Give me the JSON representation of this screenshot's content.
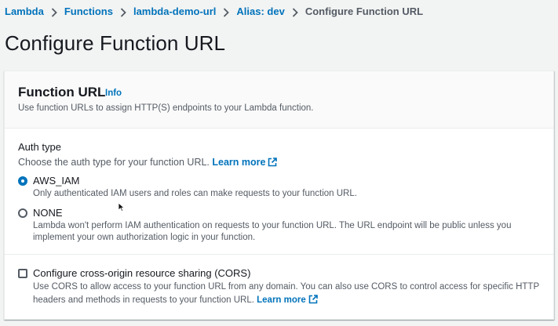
{
  "breadcrumb": {
    "items": [
      "Lambda",
      "Functions",
      "lambda-demo-url",
      "Alias: dev"
    ],
    "current": "Configure Function URL"
  },
  "page": {
    "title": "Configure Function URL"
  },
  "panel": {
    "title": "Function URL",
    "info": "Info",
    "description": "Use function URLs to assign HTTP(S) endpoints to your Lambda function."
  },
  "auth": {
    "label": "Auth type",
    "description": "Choose the auth type for your function URL.",
    "learn_more": "Learn more",
    "options": [
      {
        "label": "AWS_IAM",
        "selected": true,
        "description": "Only authenticated IAM users and roles can make requests to your function URL."
      },
      {
        "label": "NONE",
        "selected": false,
        "description": "Lambda won't perform IAM authentication on requests to your function URL. The URL endpoint will be public unless you implement your own authorization logic in your function."
      }
    ]
  },
  "cors": {
    "label": "Configure cross-origin resource sharing (CORS)",
    "checked": false,
    "description": "Use CORS to allow access to your function URL from any domain. You can also use CORS to control access for specific HTTP headers and methods in requests to your function URL.",
    "learn_more": "Learn more"
  },
  "colors": {
    "link": "#0073bb",
    "text": "#16191f",
    "secondary_text": "#545b64",
    "background": "#f2f3f3"
  }
}
